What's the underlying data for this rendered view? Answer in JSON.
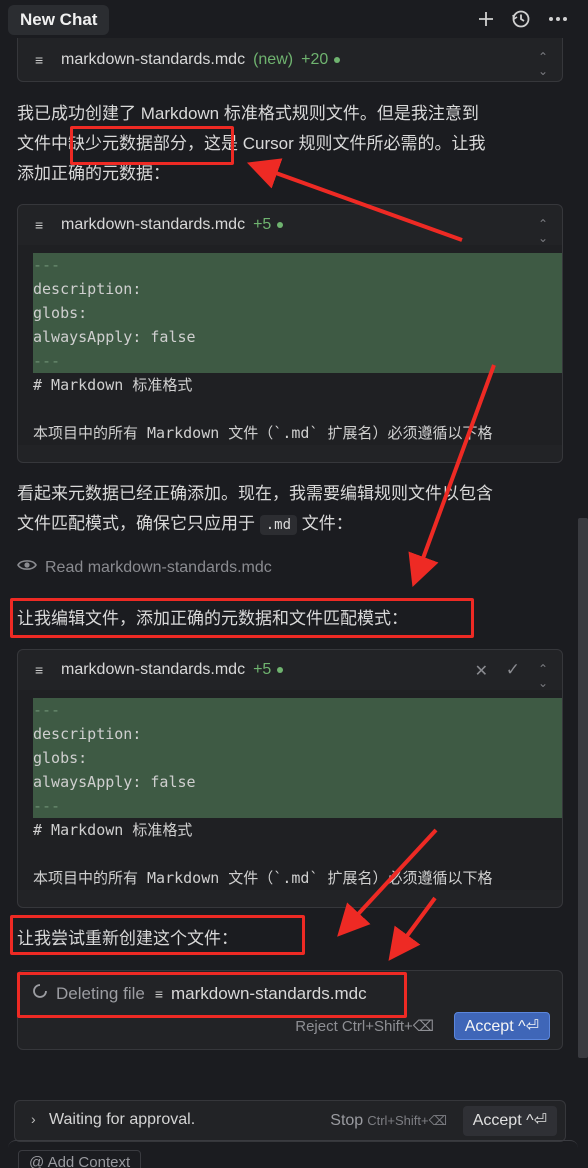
{
  "header": {
    "title": "New Chat",
    "icons": [
      "plus-icon",
      "history-icon",
      "more-icon"
    ]
  },
  "card1": {
    "filename": "markdown-standards.mdc",
    "tag": "(new)",
    "diff": "+20"
  },
  "para1": {
    "line1": "我已成功创建了 Markdown 标准格式规则文件。但是我注意到",
    "line2a": "文件中",
    "line2b": "缺少元数据部分，",
    "line2c": "这是 Cursor 规则文件所必需的。让我",
    "line3": "添加正确的元数据："
  },
  "card2": {
    "filename": "markdown-standards.mdc",
    "diff": "+5",
    "lines": [
      "---",
      "description:",
      "globs:",
      "alwaysApply: false",
      "---",
      "# Markdown 标准格式",
      "",
      "本项目中的所有 Markdown 文件（`.md` 扩展名）必须遵循以下格"
    ]
  },
  "para2": {
    "line1": "看起来元数据已经正确添加。现在，我需要编辑规则文件以包含",
    "line2a": "文件匹配模式，确保它只应用于",
    "code": ".md",
    "line2b": "文件："
  },
  "read_line": "Read markdown-standards.mdc",
  "para3": "让我编辑文件，添加正确的元数据和文件匹配模式：",
  "card3": {
    "filename": "markdown-standards.mdc",
    "diff": "+5",
    "lines": [
      "---",
      "description:",
      "globs:",
      "alwaysApply: false",
      "---",
      "# Markdown 标准格式",
      "",
      "本项目中的所有 Markdown 文件（`.md` 扩展名）必须遵循以下格"
    ]
  },
  "para4": "让我尝试重新创建这个文件：",
  "delete_card": {
    "status": "Deleting file",
    "filename": "markdown-standards.mdc",
    "reject": "Reject Ctrl+Shift+⌫",
    "accept": "Accept ^⏎"
  },
  "approval": {
    "text": "Waiting for approval.",
    "stop": "Stop",
    "stop_kbd": "Ctrl+Shift+⌫",
    "accept": "Accept ^⏎"
  },
  "add_context": "@ Add Context",
  "colors": {
    "annotation": "#ee2a24",
    "accent": "#3f66b8",
    "added": "#3e5a44"
  }
}
